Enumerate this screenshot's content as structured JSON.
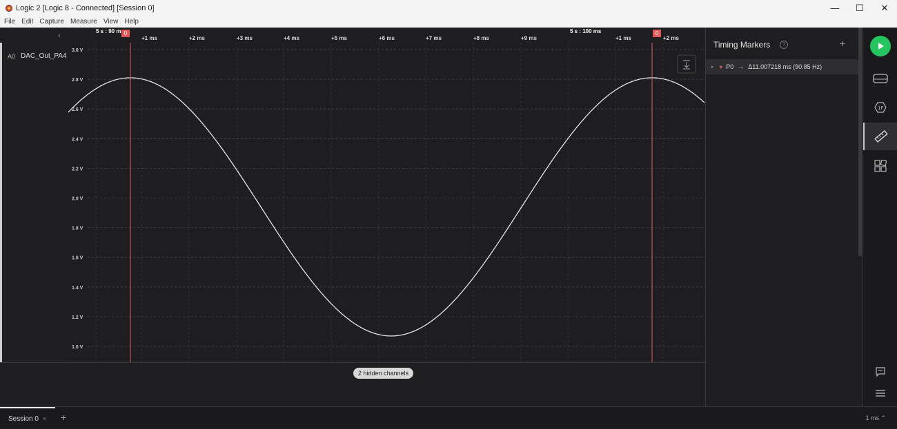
{
  "window": {
    "title": "Logic 2 [Logic 8 - Connected] [Session 0]",
    "minimize": "—",
    "maximize": "☐",
    "close": "✕"
  },
  "menu": [
    "File",
    "Edit",
    "Capture",
    "Measure",
    "View",
    "Help"
  ],
  "channel": {
    "id": "A0",
    "name": "DAC_Out_PA4",
    "collapse": "‹"
  },
  "ruler": {
    "major_left": "5 s : 90 ms",
    "major_right": "5 s : 100 ms",
    "ticks": [
      "+1 ms",
      "+2 ms",
      "+3 ms",
      "+4 ms",
      "+5 ms",
      "+6 ms",
      "+7 ms",
      "+8 ms",
      "+9 ms",
      "+1 ms",
      "+2 ms"
    ],
    "marker_flags": [
      "0",
      "0"
    ]
  },
  "axis": {
    "y_labels": [
      "3.0 V",
      "2.8 V",
      "2.6 V",
      "2.4 V",
      "2.2 V",
      "2.0 V",
      "1.8 V",
      "1.6 V",
      "1.4 V",
      "1.2 V",
      "1.0 V"
    ]
  },
  "waveform": {
    "vmin": 1.07,
    "vmax": 2.81,
    "period_ms": 11.007218,
    "color": "#e6e6e6"
  },
  "marker_color": "#e05a5a",
  "hidden_channels": "2 hidden channels",
  "side_panel": {
    "title": "Timing Markers",
    "help": "?",
    "add": "+",
    "marker": {
      "name": "P0",
      "arrow": "→",
      "delta": "Δ11.007218 ms (90.85 Hz)"
    }
  },
  "accent_green": "#22c55e",
  "status": {
    "session_tab": "Session 0",
    "close": "×",
    "add": "+",
    "zoom": "1 ms ⌃"
  }
}
